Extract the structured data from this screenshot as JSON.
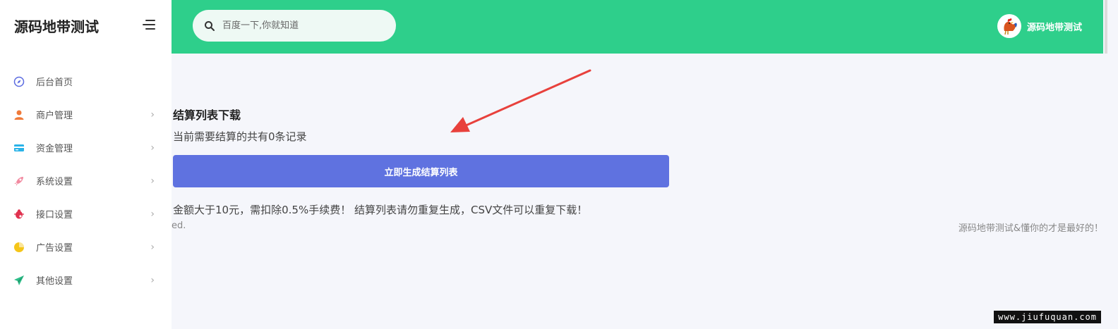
{
  "sidebar": {
    "brand": "源码地带测试",
    "items": [
      {
        "label": "后台首页",
        "icon": "compass-icon",
        "has_children": false
      },
      {
        "label": "商户管理",
        "icon": "user-icon",
        "has_children": true
      },
      {
        "label": "资金管理",
        "icon": "credit-card-icon",
        "has_children": true
      },
      {
        "label": "系统设置",
        "icon": "rocket-icon",
        "has_children": true
      },
      {
        "label": "接口设置",
        "icon": "bug-icon",
        "has_children": true
      },
      {
        "label": "广告设置",
        "icon": "pie-chart-icon",
        "has_children": true
      },
      {
        "label": "其他设置",
        "icon": "paper-plane-icon",
        "has_children": true
      }
    ],
    "chevron": "›"
  },
  "header": {
    "search_placeholder": "百度一下,你就知道",
    "user_name": "源码地带测试"
  },
  "main": {
    "title": "结算列表下载",
    "subtitle": "当前需要结算的共有0条记录",
    "generate_button": "立即生成结算列表",
    "note": "金额大于10元，需扣除0.5%手续费！ 结算列表请勿重复生成，CSV文件可以重复下载！",
    "footer_left": "ed.",
    "footer_right": "源码地带测试&懂你的才是最好的！"
  },
  "watermark": "www.jiufuquan.com",
  "colors": {
    "topbar": "#2ecf8b",
    "button": "#5f72e0",
    "arrow": "#e8413c",
    "background": "#f5f6fb"
  }
}
